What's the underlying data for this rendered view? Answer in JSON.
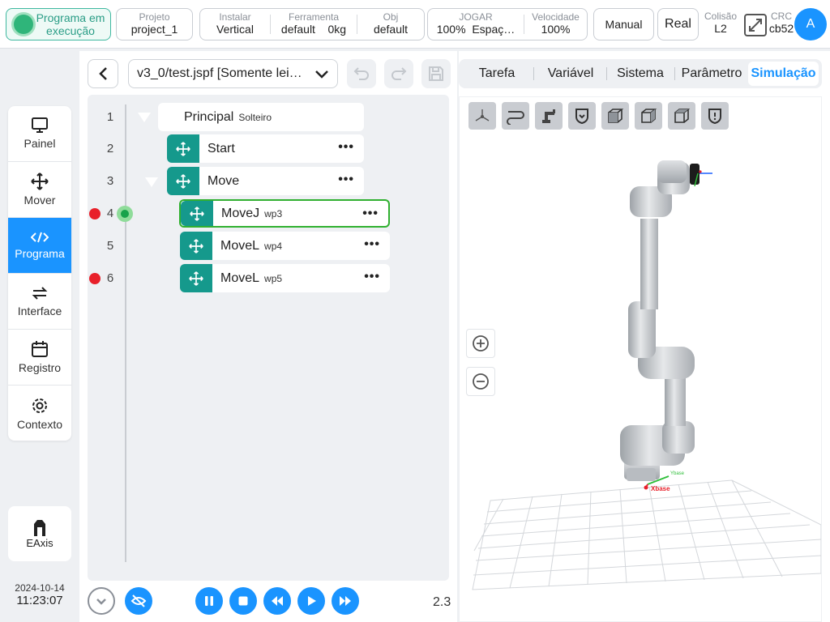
{
  "header": {
    "status": "Programa em execução",
    "project_label": "Projeto",
    "project_value": "project_1",
    "install_label": "Instalar",
    "install_value": "Vertical",
    "tool_label": "Ferramenta",
    "tool_name": "default",
    "tool_mass": "0kg",
    "obj_label": "Obj",
    "obj_value": "default",
    "jog_label": "JOGAR",
    "jog_percent": "100%",
    "jog_space": "Espaç…",
    "speed_label": "Velocidade",
    "speed_value": "100%",
    "mode_manual": "Manual",
    "mode_real": "Real",
    "collision_label": "Colisão",
    "collision_value": "L2",
    "crc_label": "CRC",
    "crc_value": "cb52",
    "avatar_letter": "A"
  },
  "sidebar": {
    "items": [
      {
        "label": "Painel",
        "icon": "monitor-icon"
      },
      {
        "label": "Mover",
        "icon": "move-icon"
      },
      {
        "label": "Programa",
        "icon": "code-icon",
        "active": true
      },
      {
        "label": "Interface",
        "icon": "swap-icon"
      },
      {
        "label": "Registro",
        "icon": "calendar-icon"
      },
      {
        "label": "Contexto",
        "icon": "gear-icon"
      }
    ],
    "eaxis_label": "EAxis",
    "date": "2024-10-14",
    "time": "11:23:07"
  },
  "program": {
    "file": "v3_0/test.jspf [Somente lei…",
    "version": "2.3",
    "lines": [
      {
        "num": "1",
        "name": "Principal",
        "sub": "Solteiro"
      },
      {
        "num": "2",
        "name": "Start",
        "sub": ""
      },
      {
        "num": "3",
        "name": "Move",
        "sub": ""
      },
      {
        "num": "4",
        "name": "MoveJ",
        "sub": "wp3",
        "breakpoint": true,
        "current": true,
        "selected": true
      },
      {
        "num": "5",
        "name": "MoveL",
        "sub": "wp4"
      },
      {
        "num": "6",
        "name": "MoveL",
        "sub": "wp5",
        "breakpoint": true
      }
    ],
    "more_glyph": "•••"
  },
  "tabs": [
    "Tarefa",
    "Variável",
    "Sistema",
    "Parâmetro",
    "Simulação"
  ],
  "active_tab": "Simulação",
  "simulation": {
    "axis_x": "Xbase",
    "axis_y": "Ybase"
  },
  "colors": {
    "accent": "#1a94ff",
    "teal": "#15998c",
    "running": "#2fb57a",
    "breakpoint": "#e8202a"
  }
}
